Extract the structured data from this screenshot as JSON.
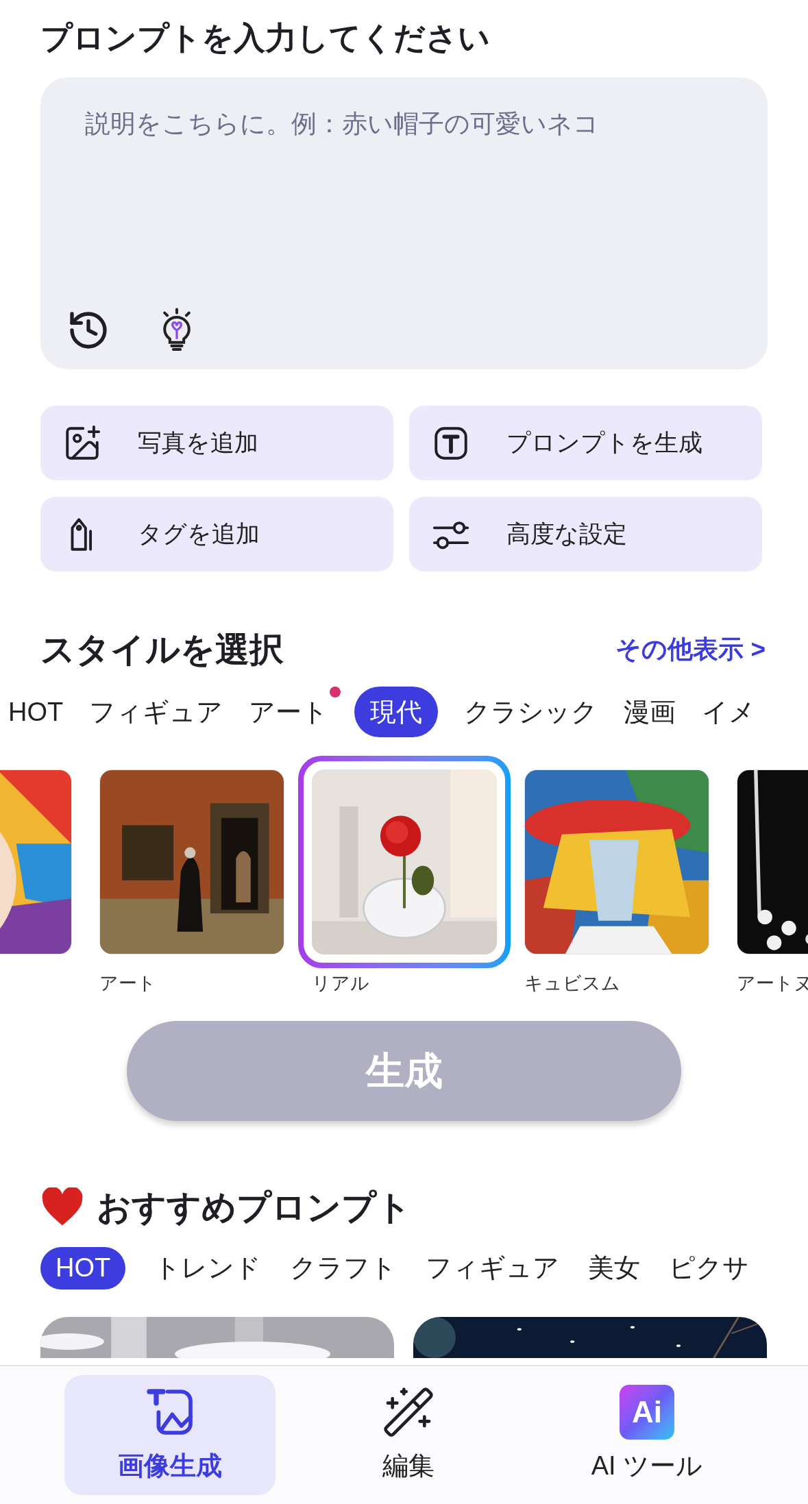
{
  "prompt": {
    "title": "プロンプトを入力してください",
    "placeholder": "説明をこちらに。例：赤い帽子の可愛いネコ"
  },
  "actions": [
    {
      "label": "写真を追加"
    },
    {
      "label": "プロンプトを生成"
    },
    {
      "label": "タグを追加"
    },
    {
      "label": "高度な設定"
    }
  ],
  "styles": {
    "title": "スタイルを選択",
    "more_link": "その他表示 >",
    "categories": [
      {
        "label": "HOT",
        "selected": false,
        "dot": false
      },
      {
        "label": "フィギュア",
        "selected": false,
        "dot": false
      },
      {
        "label": "アート",
        "selected": false,
        "dot": true
      },
      {
        "label": "現代",
        "selected": true,
        "dot": false
      },
      {
        "label": "クラシック",
        "selected": false,
        "dot": false
      },
      {
        "label": "漫画",
        "selected": false,
        "dot": false
      },
      {
        "label": "イメ",
        "selected": false,
        "dot": false
      }
    ],
    "cards": [
      {
        "kind": "picture",
        "selected": false
      },
      {
        "kind": "picture",
        "label": "アート",
        "selected": false
      },
      {
        "kind": "picture",
        "label": "リアル",
        "selected": true
      },
      {
        "kind": "picture",
        "label": "キュビスム",
        "selected": false
      },
      {
        "kind": "picture",
        "label": "アートヌ",
        "selected": false
      }
    ]
  },
  "generate_button": "生成",
  "recommended": {
    "title": "おすすめプロンプト",
    "tabs": [
      {
        "label": "HOT",
        "selected": true
      },
      {
        "label": "トレンド",
        "selected": false
      },
      {
        "label": "クラフト",
        "selected": false
      },
      {
        "label": "フィギュア",
        "selected": false
      },
      {
        "label": "美女",
        "selected": false
      },
      {
        "label": "ピクサ",
        "selected": false
      }
    ],
    "cards": [
      {
        "kind": "picture"
      },
      {
        "kind": "picture"
      }
    ]
  },
  "bottom_nav": [
    {
      "label": "画像生成",
      "selected": true
    },
    {
      "label": "編集",
      "selected": false
    },
    {
      "label": "AI ツール",
      "selected": false,
      "icon_text": "Ai"
    }
  ]
}
